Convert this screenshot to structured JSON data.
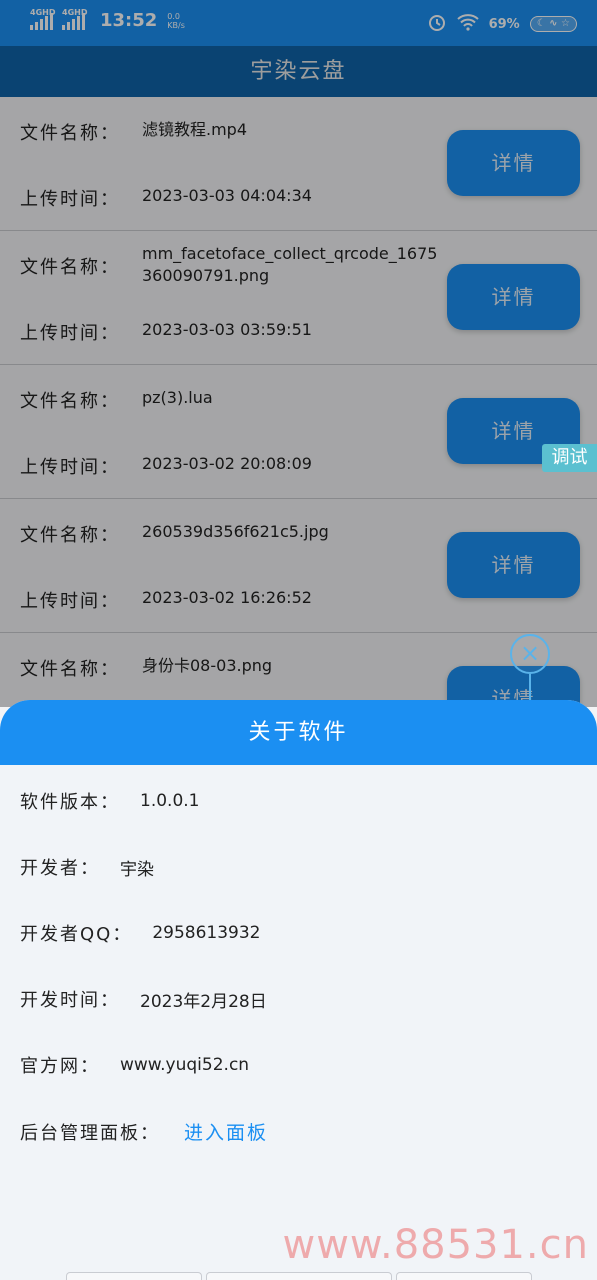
{
  "status_bar": {
    "network_1": "4GHD",
    "network_2": "4GHD",
    "time": "13:52",
    "speed_value": "0.0",
    "speed_unit": "KB/s",
    "battery": "69%",
    "icons": [
      "alarm-icon",
      "wifi-icon",
      "moon-icon"
    ]
  },
  "app": {
    "title": "宇染云盘"
  },
  "files": [
    {
      "name_label": "文件名称：",
      "name": "滤镜教程.mp4",
      "time_label": "上传时间：",
      "time": "2023-03-03 04:04:34",
      "button": "详情"
    },
    {
      "name_label": "文件名称：",
      "name": "mm_facetoface_collect_qrcode_1675360090791.png",
      "time_label": "上传时间：",
      "time": "2023-03-03 03:59:51",
      "button": "详情"
    },
    {
      "name_label": "文件名称：",
      "name": "pz(3).lua",
      "time_label": "上传时间：",
      "time": "2023-03-02 20:08:09",
      "button": "详情"
    },
    {
      "name_label": "文件名称：",
      "name": "260539d356f621c5.jpg",
      "time_label": "上传时间：",
      "time": "2023-03-02 16:26:52",
      "button": "详情"
    },
    {
      "name_label": "文件名称：",
      "name": "身份卡08-03.png",
      "button": "详情"
    }
  ],
  "debug_badge": "调试",
  "close_icon": "×",
  "about": {
    "title": "关于软件",
    "version_label": "软件版本：",
    "version": "1.0.0.1",
    "developer_label": "开发者：",
    "developer": "宇染",
    "qq_label": "开发者QQ：",
    "qq": "2958613932",
    "dev_time_label": "开发时间：",
    "dev_time": "2023年2月28日",
    "website_label": "官方网：",
    "website": "www.yuqi52.cn",
    "admin_label": "后台管理面板：",
    "admin_link": "进入面板"
  },
  "watermark": "www.88531.cn"
}
